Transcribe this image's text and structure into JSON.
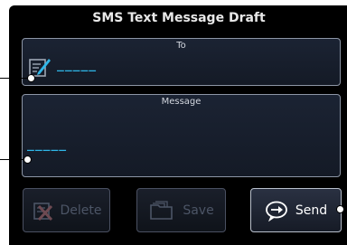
{
  "dialog": {
    "title": "SMS Text Message Draft"
  },
  "to_field": {
    "label": "To",
    "value": "_____",
    "icon": "edit-pencil-icon"
  },
  "message_field": {
    "label": "Message",
    "value": "_____"
  },
  "buttons": {
    "delete_label": "Delete",
    "save_label": "Save",
    "send_label": "Send"
  },
  "colors": {
    "background": "#000000",
    "field_border": "#8d96a6",
    "accent_cyan": "#2fb6e8",
    "disabled_text": "#4c5566"
  }
}
